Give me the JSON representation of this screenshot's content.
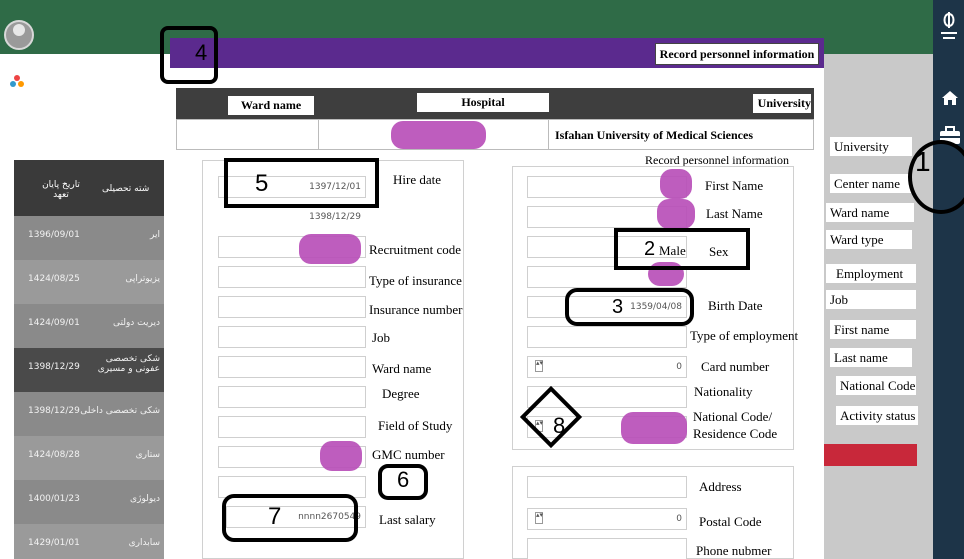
{
  "dialog": {
    "title": "Record personnel information"
  },
  "table": {
    "headers": {
      "ward": "Ward name",
      "hospital": "Hospital",
      "university": "University"
    },
    "row": {
      "university": "Isfahan University of Medical Sciences"
    }
  },
  "left_form": {
    "hire_date_label": "Hire date",
    "hire_date_value": "1397/12/01",
    "date2_value": "1398/12/29",
    "recruitment_code_label": "Recruitment code",
    "type_insurance_label": "Type of insurance",
    "insurance_number_label": "Insurance number",
    "job_label": "Job",
    "ward_name_label": "Ward name",
    "degree_label": "Degree",
    "field_label": "Field of Study",
    "gmc_label": "GMC number",
    "last_salary_label": "Last salary",
    "last_salary_value": "nnnn2670549"
  },
  "right_form": {
    "section_title": "Record personnel information",
    "first_name_label": "First Name",
    "last_name_label": "Last Name",
    "sex_label": "Sex",
    "sex_value": "Male",
    "birth_date_label": "Birth Date",
    "birth_date_value": "1359/04/08",
    "type_employment_label": "Type of employment",
    "card_number_label": "Card number",
    "card_number_value": "0",
    "nationality_label": "Nationality",
    "national_code_label_1": "National Code/",
    "national_code_label_2": "Residence Code",
    "address_label": "Address",
    "postal_code_label": "Postal Code",
    "postal_code_value": "0",
    "phone_label": "Phone nubmer"
  },
  "right_sidebar": {
    "labels": [
      "University",
      "Center name",
      "Ward name",
      "Ward type",
      "Employment",
      "Job",
      "First name",
      "Last name",
      "National Code",
      "Activity status"
    ]
  },
  "left_table": {
    "header_col1": "تاریخ پایان تعهد",
    "header_col2": "شته تحصیلی",
    "rows": [
      {
        "date": "1396/09/01",
        "field": "ایر"
      },
      {
        "date": "1424/08/25",
        "field": "یزیوتراپی"
      },
      {
        "date": "1424/09/01",
        "field": "دیریت دولتی"
      },
      {
        "date": "1398/12/29",
        "field": "شکی تخصصی عفونی و مسیری"
      },
      {
        "date": "1398/12/29",
        "field": "شکی تخصصی داخلی"
      },
      {
        "date": "1424/08/28",
        "field": "ستاری"
      },
      {
        "date": "1400/01/23",
        "field": "دیولوژی"
      },
      {
        "date": "1429/01/01",
        "field": "سابداری"
      }
    ]
  },
  "callouts": {
    "c1": "1",
    "c2": "2",
    "c3": "3",
    "c4": "4",
    "c5": "5",
    "c6": "6",
    "c7": "7",
    "c8": "8"
  },
  "colors": {
    "header_purple": "#5b2a8e",
    "top_green": "#2f6b47",
    "sidebar_navy": "#1d3448",
    "blob": "#b84fb8",
    "red": "#c8283a"
  }
}
